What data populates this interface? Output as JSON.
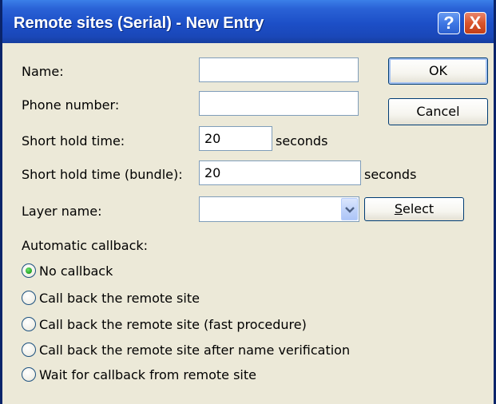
{
  "window": {
    "title": "Remote sites (Serial) - New Entry",
    "help_label": "?",
    "close_label": "X"
  },
  "form": {
    "name_label": "Name:",
    "name_value": "",
    "phone_label": "Phone number:",
    "phone_value": "",
    "short_hold_label": "Short hold time:",
    "short_hold_value": "20",
    "short_hold_unit": "seconds",
    "short_hold_bundle_label": "Short hold time (bundle):",
    "short_hold_bundle_value": "20",
    "short_hold_bundle_unit": "seconds",
    "layer_label": "Layer name:",
    "layer_value": "",
    "select_button_mnemonic": "S",
    "select_button_rest": "elect",
    "callback_label": "Automatic callback:",
    "callback_options": [
      {
        "label": "No callback",
        "selected": true
      },
      {
        "label": "Call back the remote site",
        "selected": false
      },
      {
        "label": "Call back the remote site (fast procedure)",
        "selected": false
      },
      {
        "label": "Call back the remote site after name verification",
        "selected": false
      },
      {
        "label": "Wait for callback from remote site",
        "selected": false
      }
    ]
  },
  "buttons": {
    "ok_label": "OK",
    "cancel_label": "Cancel"
  },
  "colors": {
    "titlebar": "#1c4fc7",
    "dialog_background": "#ece9d8",
    "radio_selected": "#21a121"
  },
  "icons": {
    "help": "question-mark-icon",
    "close": "close-x-icon",
    "dropdown": "chevron-down-icon"
  }
}
